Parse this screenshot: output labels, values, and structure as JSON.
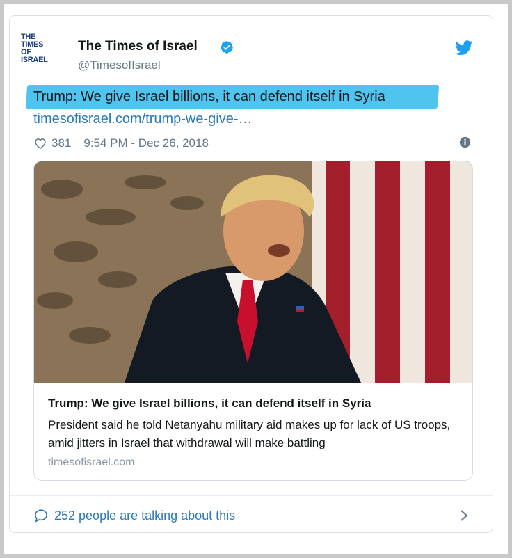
{
  "account": {
    "logo_line1": "THE TIMES",
    "logo_line2": "OF ISRAEL",
    "name": "The Times of Israel",
    "handle": "@TimesofIsrael",
    "verified_icon": "verified-badge-icon",
    "platform_icon": "twitter-bird-icon"
  },
  "tweet": {
    "text": "Trump: We give Israel billions, it can defend itself in Syria",
    "link": "timesofisrael.com/trump-we-give-…",
    "likes": "381",
    "timestamp": "9:54 PM - Dec 26, 2018"
  },
  "card": {
    "image_alt": "Donald Trump speaking in front of a US flag",
    "title": "Trump: We give Israel billions, it can defend itself in Syria",
    "description": "President said he told Netanyahu military aid makes up for lack of US troops, amid jitters in Israel that withdrawal will make battling",
    "domain": "timesofisrael.com"
  },
  "footer": {
    "talking": "252 people are talking about this"
  },
  "colors": {
    "link": "#2b7bb9",
    "highlight": "#4fc4ef",
    "verified": "#1da1f2",
    "secondary_text": "#657786"
  }
}
